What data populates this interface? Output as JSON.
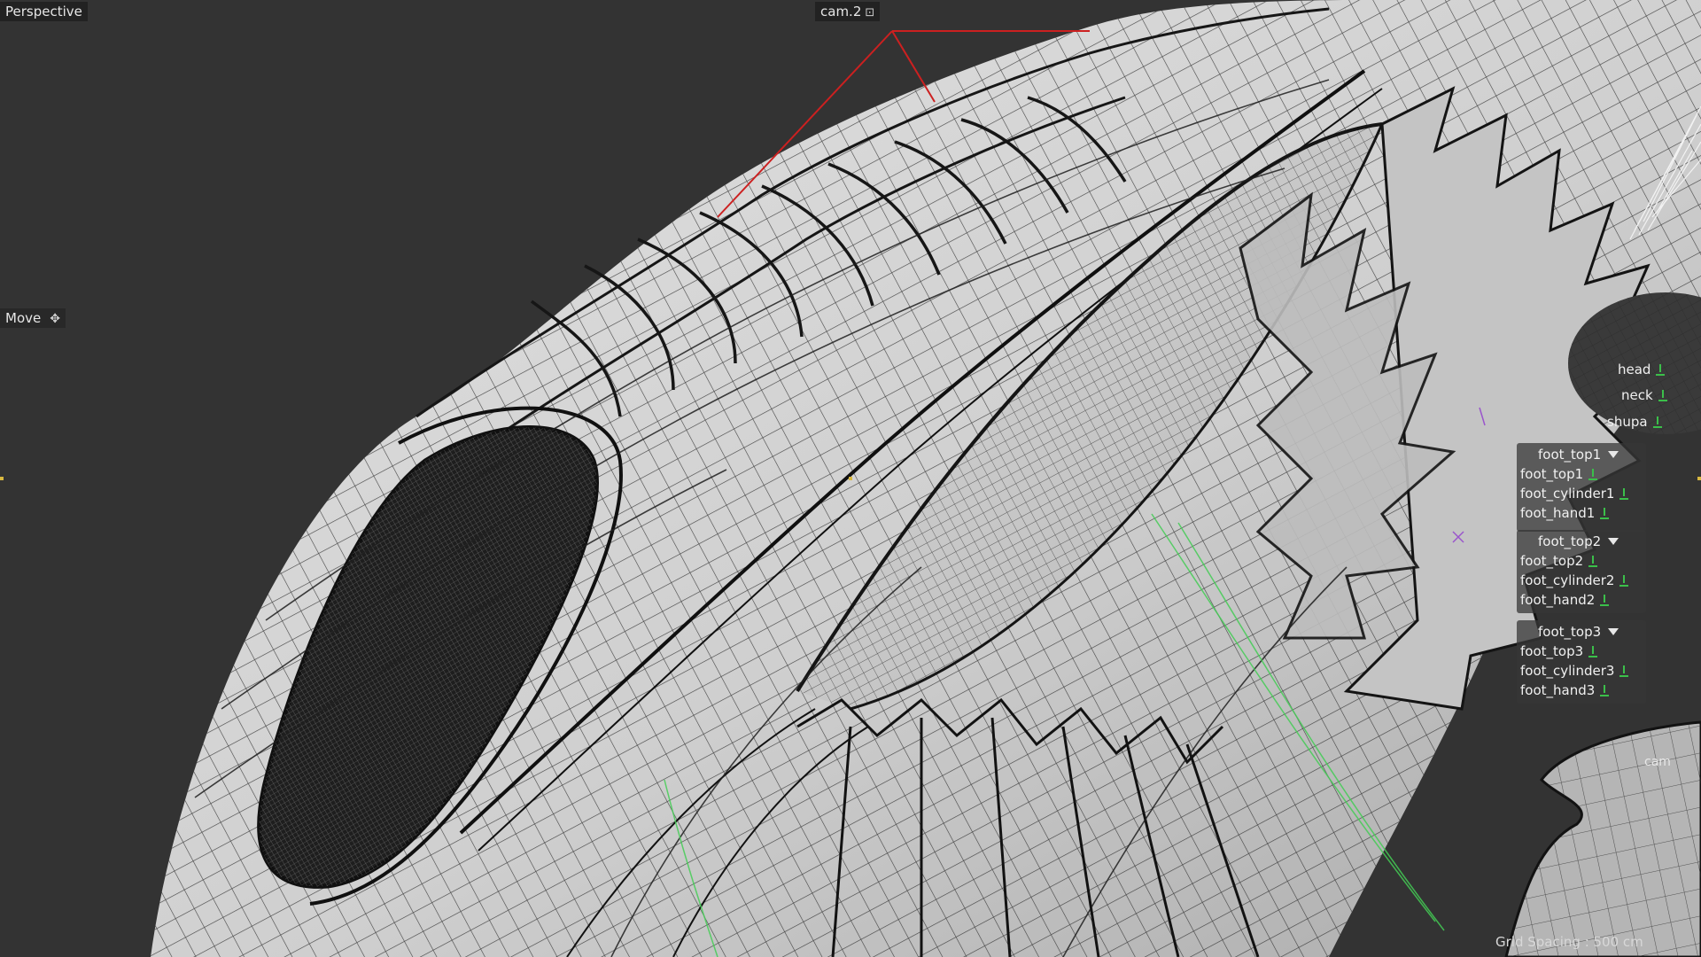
{
  "viewport": {
    "view_name": "Perspective",
    "camera_name": "cam.2",
    "camera_icon": "camera-icon",
    "tool_name": "Move",
    "tool_icon": "move-icon",
    "grid_spacing": "Grid Spacing : 500 cm",
    "cam_tag": "cam"
  },
  "outliner": {
    "top_nodes": [
      {
        "label": "head"
      },
      {
        "label": "neck"
      },
      {
        "label": "shupa"
      }
    ],
    "groups": [
      {
        "title": "foot_top1",
        "children": [
          "foot_top1",
          "foot_cylinder1",
          "foot_hand1"
        ]
      },
      {
        "title": "foot_top2",
        "children": [
          "foot_top2",
          "foot_cylinder2",
          "foot_hand2"
        ]
      },
      {
        "title": "foot_top3",
        "children": [
          "foot_top3",
          "foot_cylinder3",
          "foot_hand3"
        ]
      }
    ]
  },
  "colors": {
    "background": "#333333",
    "mesh_fill": "#d9d9d9",
    "wire": "#1a1a1a",
    "camera_frustum": "#cc2020",
    "lock_green": "#3bbf4a"
  }
}
